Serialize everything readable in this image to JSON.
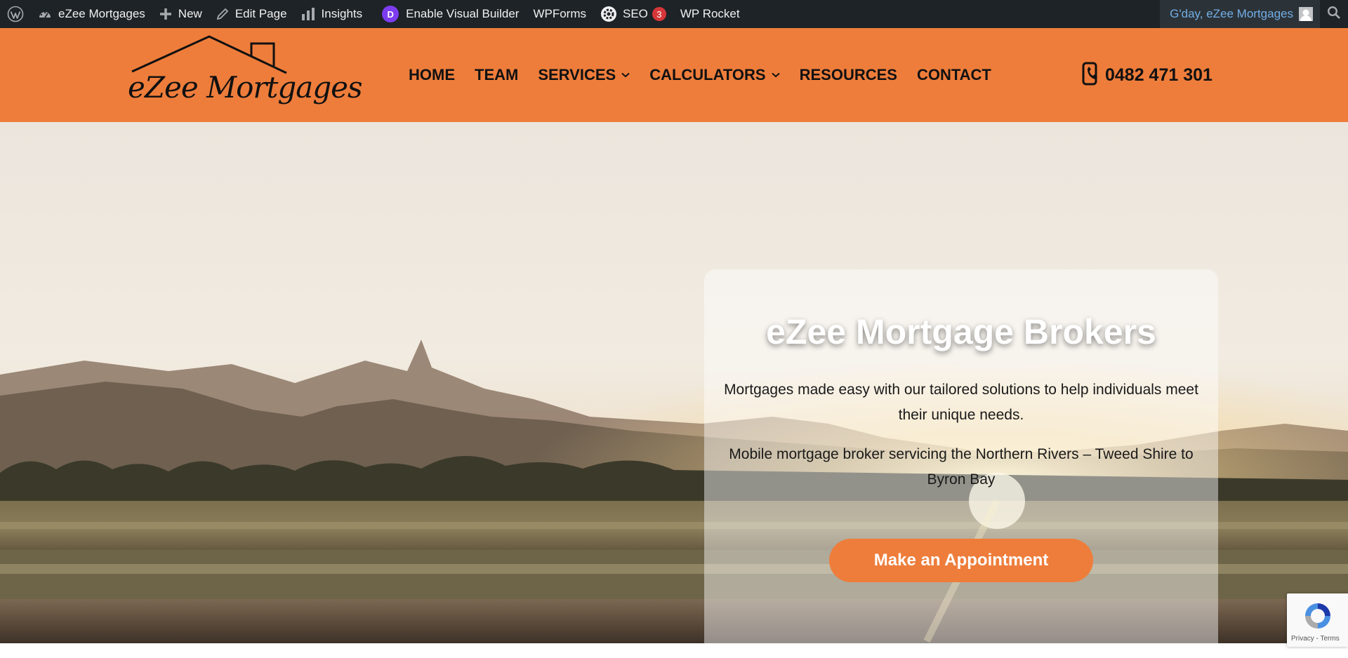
{
  "admin_bar": {
    "site_name": "eZee Mortgages",
    "new_label": "New",
    "edit_page_label": "Edit Page",
    "insights_label": "Insights",
    "visual_builder_badge": "D",
    "visual_builder_label": "Enable Visual Builder",
    "wpforms_label": "WPForms",
    "seo_label": "SEO",
    "seo_count": "3",
    "rocket_label": "WP Rocket",
    "greeting": "G'day, eZee Mortgages"
  },
  "header": {
    "logo_text": "eZee Mortgages",
    "nav": [
      {
        "label": "HOME",
        "has_dropdown": false
      },
      {
        "label": "TEAM",
        "has_dropdown": false
      },
      {
        "label": "SERVICES",
        "has_dropdown": true
      },
      {
        "label": "CALCULATORS",
        "has_dropdown": true
      },
      {
        "label": "RESOURCES",
        "has_dropdown": false
      },
      {
        "label": "CONTACT",
        "has_dropdown": false
      }
    ],
    "phone": "0482 471 301"
  },
  "hero": {
    "title": "eZee Mortgage Brokers",
    "paragraph1": "Mortgages made easy with our tailored solutions to help individuals meet their unique needs.",
    "paragraph2": "Mobile mortgage broker servicing the Northern Rivers – Tweed Shire to Byron Bay",
    "cta_label": "Make an Appointment"
  },
  "recaptcha": {
    "links": "Privacy - Terms"
  },
  "colors": {
    "brand_orange": "#ee7d3b",
    "admin_bar_bg": "#1d2327",
    "admin_link_blue": "#72aee6",
    "badge_red": "#d63638",
    "divi_purple": "#7d3cf0"
  },
  "icons": [
    "wordpress-icon",
    "dashboard-icon",
    "plus-icon",
    "pencil-icon",
    "bar-chart-icon",
    "divi-icon",
    "seo-gear-icon",
    "avatar-icon",
    "search-icon",
    "phone-icon",
    "chevron-down-icon",
    "recaptcha-icon"
  ]
}
